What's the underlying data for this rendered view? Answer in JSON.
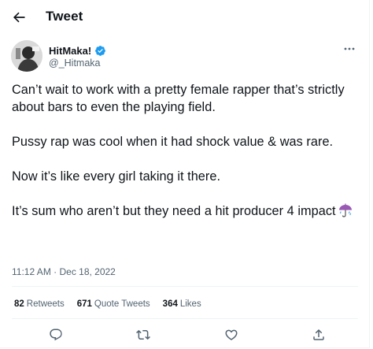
{
  "header": {
    "title": "Tweet",
    "back_icon": "arrow-left-icon"
  },
  "author": {
    "name": "HitMaka!",
    "handle": "@_Hitmaka",
    "verified_color": "#1d9bf0"
  },
  "tweet": {
    "paragraphs": [
      "Can’t wait to work with a pretty female rapper that’s strictly about bars to even the playing field.",
      "Pussy rap was cool when it had shock value & was rare.",
      "Now it’s like every girl taking it there.",
      "It’s sum who aren’t but they need a hit producer 4 impact"
    ],
    "emoji": "umbrella-rain-icon",
    "time": "11:12 AM · Dec 18, 2022"
  },
  "stats": {
    "retweets_count": "82",
    "retweets_label": "Retweets",
    "quotes_count": "671",
    "quotes_label": "Quote Tweets",
    "likes_count": "364",
    "likes_label": "Likes"
  },
  "actions": [
    "reply-icon",
    "retweet-icon",
    "like-icon",
    "share-icon"
  ]
}
